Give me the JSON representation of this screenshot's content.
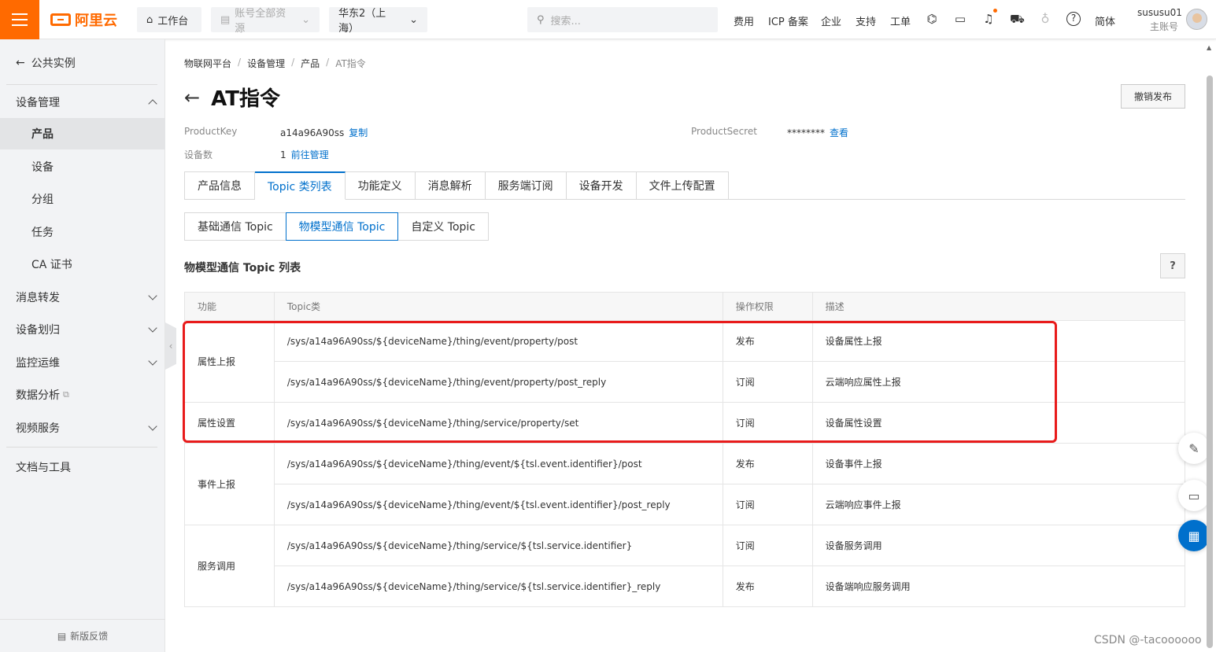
{
  "header": {
    "logo_text": "阿里云",
    "workbench": "工作台",
    "account_scope": "账号全部资源",
    "region": "华东2（上海）",
    "search_placeholder": "搜索...",
    "links": [
      "费用",
      "ICP 备案",
      "企业",
      "支持",
      "工单"
    ],
    "lang": "简体",
    "user_name": "sususu01",
    "user_role": "主账号"
  },
  "sidebar": {
    "back_label": "公共实例",
    "items": [
      {
        "label": "设备管理"
      },
      {
        "label": "产品"
      },
      {
        "label": "设备"
      },
      {
        "label": "分组"
      },
      {
        "label": "任务"
      },
      {
        "label": "CA 证书"
      },
      {
        "label": "消息转发"
      },
      {
        "label": "设备划归"
      },
      {
        "label": "监控运维"
      },
      {
        "label": "数据分析"
      },
      {
        "label": "视频服务"
      },
      {
        "label": "文档与工具"
      }
    ],
    "feedback": "新版反馈"
  },
  "breadcrumb": [
    "物联网平台",
    "设备管理",
    "产品",
    "AT指令"
  ],
  "page": {
    "title": "AT指令",
    "revoke_button": "撤销发布",
    "product_key_label": "ProductKey",
    "product_key_value": "a14a96A90ss",
    "copy_link": "复制",
    "product_secret_label": "ProductSecret",
    "product_secret_value": "********",
    "view_link": "查看",
    "device_count_label": "设备数",
    "device_count_value": "1",
    "manage_link": "前往管理"
  },
  "tabs": [
    "产品信息",
    "Topic 类列表",
    "功能定义",
    "消息解析",
    "服务端订阅",
    "设备开发",
    "文件上传配置"
  ],
  "subtabs": [
    "基础通信 Topic",
    "物模型通信 Topic",
    "自定义 Topic"
  ],
  "section_title": "物模型通信 Topic 列表",
  "table": {
    "headers": [
      "功能",
      "Topic类",
      "操作权限",
      "描述"
    ],
    "groups": [
      {
        "func": "属性上报",
        "rows": [
          {
            "topic": "/sys/a14a96A90ss/${deviceName}/thing/event/property/post",
            "perm": "发布",
            "desc": "设备属性上报"
          },
          {
            "topic": "/sys/a14a96A90ss/${deviceName}/thing/event/property/post_reply",
            "perm": "订阅",
            "desc": "云端响应属性上报"
          }
        ]
      },
      {
        "func": "属性设置",
        "rows": [
          {
            "topic": "/sys/a14a96A90ss/${deviceName}/thing/service/property/set",
            "perm": "订阅",
            "desc": "设备属性设置"
          }
        ]
      },
      {
        "func": "事件上报",
        "rows": [
          {
            "topic": "/sys/a14a96A90ss/${deviceName}/thing/event/${tsl.event.identifier}/post",
            "perm": "发布",
            "desc": "设备事件上报"
          },
          {
            "topic": "/sys/a14a96A90ss/${deviceName}/thing/event/${tsl.event.identifier}/post_reply",
            "perm": "订阅",
            "desc": "云端响应事件上报"
          }
        ]
      },
      {
        "func": "服务调用",
        "rows": [
          {
            "topic": "/sys/a14a96A90ss/${deviceName}/thing/service/${tsl.service.identifier}",
            "perm": "订阅",
            "desc": "设备服务调用"
          },
          {
            "topic": "/sys/a14a96A90ss/${deviceName}/thing/service/${tsl.service.identifier}_reply",
            "perm": "发布",
            "desc": "设备端响应服务调用"
          }
        ]
      }
    ]
  },
  "watermark": "CSDN @-tacoooooo"
}
